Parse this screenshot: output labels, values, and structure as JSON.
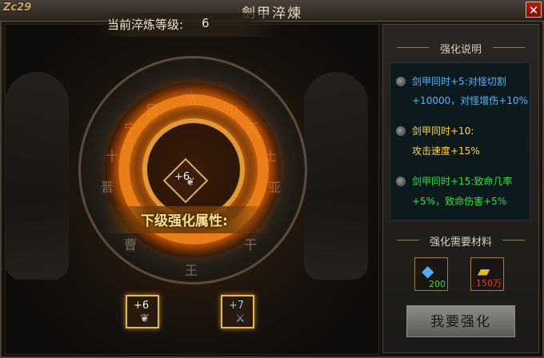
{
  "window": {
    "logo_text": "Zc29",
    "title": "劍甲淬煉",
    "close_label": "✕"
  },
  "main": {
    "level_label": "当前淬炼等级:",
    "level_value": "6",
    "center_item_level": "+6",
    "next_label": "下级强化属性:",
    "current_item_level": "+6",
    "next_item_level": "+7",
    "runes": [
      "帝",
      "天",
      "亚",
      "干",
      "王",
      "曹",
      "晋",
      "宁",
      "巾",
      "土",
      "目",
      "十"
    ]
  },
  "panel": {
    "desc_title": "强化说明",
    "descriptions": [
      {
        "line1": "剑甲同时+5:对怪切割",
        "line2": "+10000，对怪增伤+10%",
        "color": "#4fb6ff"
      },
      {
        "line1": "剑甲同时+10:",
        "line2": "攻击速度+15%",
        "color": "#ffd24a"
      },
      {
        "line1": "剑甲同时+15:致命几率",
        "line2": "+5%，致命伤害+5%",
        "color": "#33e03a"
      }
    ],
    "materials_title": "强化需要材料",
    "materials": [
      {
        "icon": "crystal-icon",
        "count": "200",
        "color": "#33e03a"
      },
      {
        "icon": "gold-ingot-icon",
        "count": "150万",
        "color": "#ff3a2a"
      }
    ],
    "upgrade_button": "我要强化"
  }
}
